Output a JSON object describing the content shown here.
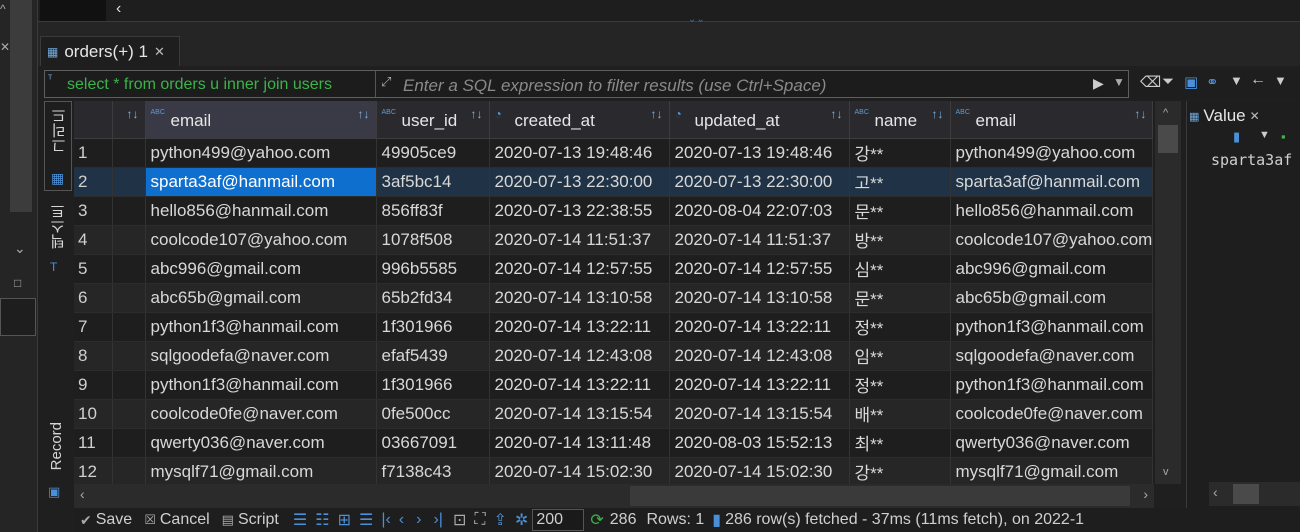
{
  "tab": {
    "title": "orders(+) 1"
  },
  "filter": {
    "sql_preview": "select * from orders u inner join users",
    "placeholder": "Enter a SQL expression to filter results (use Ctrl+Space)"
  },
  "side_tabs": {
    "grid": "그리드",
    "text": "텍스트",
    "record": "Record"
  },
  "columns": [
    "email",
    "user_id",
    "created_at",
    "updated_at",
    "name",
    "email"
  ],
  "rows": [
    {
      "n": "1",
      "c": [
        "python499@yahoo.com",
        "49905ce9",
        "2020-07-13 19:48:46",
        "2020-07-13 19:48:46",
        "강**",
        "python499@yahoo.com"
      ]
    },
    {
      "n": "2",
      "c": [
        "sparta3af@hanmail.com",
        "3af5bc14",
        "2020-07-13 22:30:00",
        "2020-07-13 22:30:00",
        "고**",
        "sparta3af@hanmail.com"
      ]
    },
    {
      "n": "3",
      "c": [
        "hello856@hanmail.com",
        "856ff83f",
        "2020-07-13 22:38:55",
        "2020-08-04 22:07:03",
        "문**",
        "hello856@hanmail.com"
      ]
    },
    {
      "n": "4",
      "c": [
        "coolcode107@yahoo.com",
        "1078f508",
        "2020-07-14 11:51:37",
        "2020-07-14 11:51:37",
        "방**",
        "coolcode107@yahoo.com"
      ]
    },
    {
      "n": "5",
      "c": [
        "abc996@gmail.com",
        "996b5585",
        "2020-07-14 12:57:55",
        "2020-07-14 12:57:55",
        "심**",
        "abc996@gmail.com"
      ]
    },
    {
      "n": "6",
      "c": [
        "abc65b@gmail.com",
        "65b2fd34",
        "2020-07-14 13:10:58",
        "2020-07-14 13:10:58",
        "문**",
        "abc65b@gmail.com"
      ]
    },
    {
      "n": "7",
      "c": [
        "python1f3@hanmail.com",
        "1f301966",
        "2020-07-14 13:22:11",
        "2020-07-14 13:22:11",
        "정**",
        "python1f3@hanmail.com"
      ]
    },
    {
      "n": "8",
      "c": [
        "sqlgoodefa@naver.com",
        "efaf5439",
        "2020-07-14 12:43:08",
        "2020-07-14 12:43:08",
        "임**",
        "sqlgoodefa@naver.com"
      ]
    },
    {
      "n": "9",
      "c": [
        "python1f3@hanmail.com",
        "1f301966",
        "2020-07-14 13:22:11",
        "2020-07-14 13:22:11",
        "정**",
        "python1f3@hanmail.com"
      ]
    },
    {
      "n": "10",
      "c": [
        "coolcode0fe@naver.com",
        "0fe500cc",
        "2020-07-14 13:15:54",
        "2020-07-14 13:15:54",
        "배**",
        "coolcode0fe@naver.com"
      ]
    },
    {
      "n": "11",
      "c": [
        "qwerty036@naver.com",
        "03667091",
        "2020-07-14 13:11:48",
        "2020-08-03 15:52:13",
        "최**",
        "qwerty036@naver.com"
      ]
    },
    {
      "n": "12",
      "c": [
        "mysqlf71@gmail.com",
        "f7138c43",
        "2020-07-14 15:02:30",
        "2020-07-14 15:02:30",
        "강**",
        "mysqlf71@gmail.com"
      ]
    }
  ],
  "value_panel": {
    "title": "Value",
    "content": "sparta3af"
  },
  "bottom": {
    "save": "Save",
    "cancel": "Cancel",
    "script": "Script",
    "fetch_size": "200",
    "count": "286",
    "rows": "Rows: 1",
    "status": "286 row(s) fetched - 37ms (11ms fetch), on 2022-1"
  }
}
